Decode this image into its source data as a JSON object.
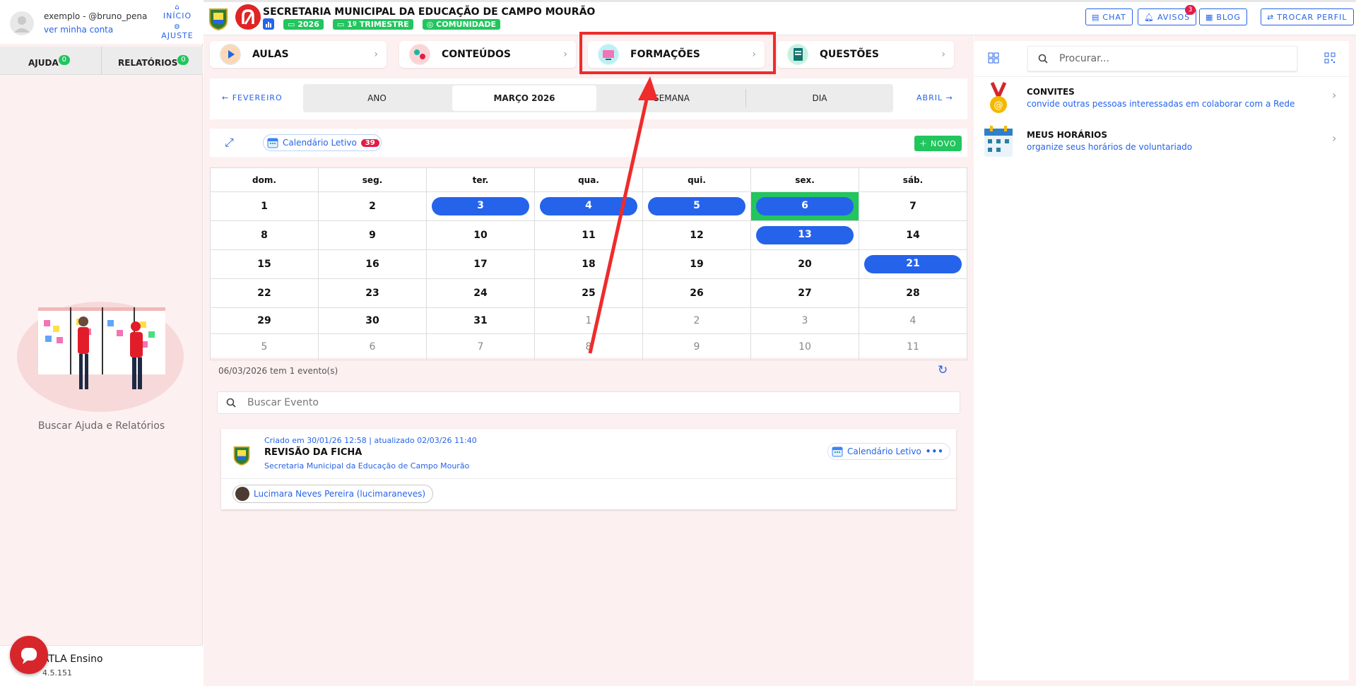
{
  "user": {
    "name": "exemplo - @bruno_pena",
    "account_link": "ver minha conta",
    "home_label": "INÍCIO",
    "settings_label": "AJUSTE"
  },
  "sidebar": {
    "tabs": [
      {
        "label": "AJUDA",
        "count": "0"
      },
      {
        "label": "RELATÓRIOS",
        "count": "0"
      }
    ],
    "caption": "Buscar Ajuda e Relatórios",
    "app_name": "ATLA Ensino",
    "version": "4.5.151"
  },
  "header": {
    "org_title": "SECRETARIA MUNICIPAL DA EDUCAÇÃO DE CAMPO MOURÃO",
    "year": "2026",
    "period": "1º TRIMESTRE",
    "community": "COMUNIDADE",
    "buttons": {
      "chat": "CHAT",
      "avisos": "AVISOS",
      "avisos_count": "3",
      "blog": "BLOG",
      "trocar": "TROCAR PERFIL"
    }
  },
  "categories": [
    {
      "label": "AULAS"
    },
    {
      "label": "CONTEÚDOS"
    },
    {
      "label": "FORMAÇÕES"
    },
    {
      "label": "QUESTÕES"
    }
  ],
  "calendar_nav": {
    "prev": "FEVEREIRO",
    "next": "ABRIL",
    "views": [
      "ANO",
      "MARÇO 2026",
      "SEMANA",
      "DIA"
    ],
    "active_view": "MARÇO 2026"
  },
  "calendar_toolbar": {
    "calendar_chip": "Calendário Letivo",
    "calendar_count": "39",
    "new_button": "NOVO"
  },
  "calendar": {
    "weekdays": [
      "dom.",
      "seg.",
      "ter.",
      "qua.",
      "qui.",
      "sex.",
      "sáb."
    ],
    "weeks": [
      [
        "1",
        "2",
        "3",
        "4",
        "5",
        "6",
        "7"
      ],
      [
        "8",
        "9",
        "10",
        "11",
        "12",
        "13",
        "14"
      ],
      [
        "15",
        "16",
        "17",
        "18",
        "19",
        "20",
        "21"
      ],
      [
        "22",
        "23",
        "24",
        "25",
        "26",
        "27",
        "28"
      ],
      [
        "29",
        "30",
        "31",
        "1",
        "2",
        "3",
        "4"
      ],
      [
        "5",
        "6",
        "7",
        "8",
        "9",
        "10",
        "11"
      ]
    ]
  },
  "events_panel": {
    "summary": "06/03/2026 tem 1 evento(s)",
    "search_placeholder": "Buscar Evento",
    "event": {
      "meta": "Criado em 30/01/26 12:58 | atualizado 02/03/26 11:40",
      "title": "REVISÃO DA FICHA",
      "org": "Secretaria Municipal da Educação de Campo Mourão",
      "calendar_label": "Calendário Letivo",
      "participant": "Lucimara Neves Pereira (lucimaraneves)"
    }
  },
  "right_panel": {
    "search_placeholder": "Procurar...",
    "items": [
      {
        "title": "CONVITES",
        "subtitle": "convide outras pessoas interessadas em colaborar com a Rede"
      },
      {
        "title": "MEUS HORÁRIOS",
        "subtitle": "organize seus horários de voluntariado"
      }
    ]
  },
  "colors": {
    "accent_blue": "#2563eb",
    "success_green": "#22c55e",
    "annotation_red": "#ef2b2b",
    "badge_red": "#e11d48"
  }
}
